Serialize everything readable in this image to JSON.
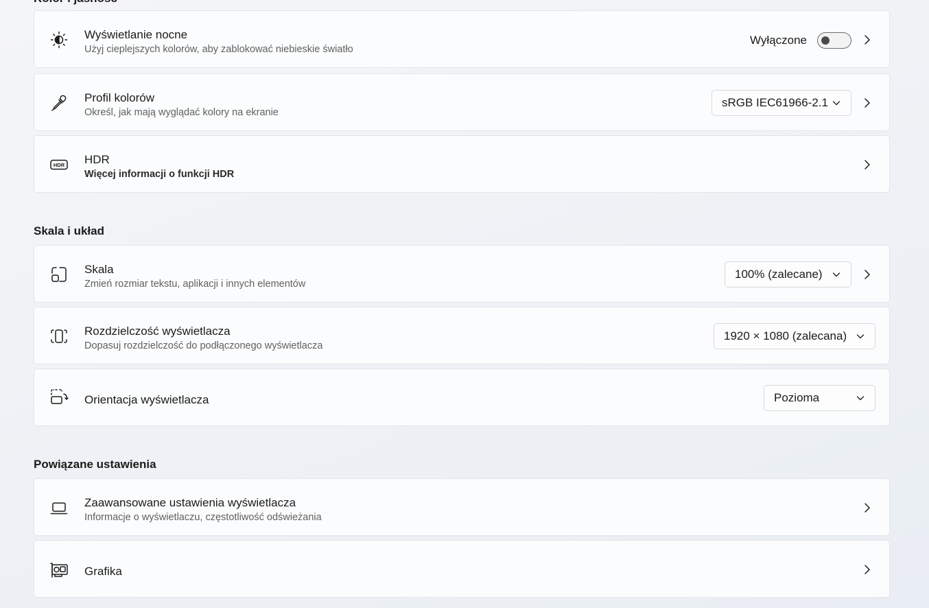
{
  "sections": {
    "color_brightness": {
      "title": "Kolor i jasność"
    },
    "scale_layout": {
      "title": "Skala i układ"
    },
    "related": {
      "title": "Powiązane ustawienia"
    }
  },
  "night_light": {
    "title": "Wyświetlanie nocne",
    "subtitle": "Użyj cieplejszych kolorów, aby zablokować niebieskie światło",
    "toggle_label": "Wyłączone",
    "toggle_on": false,
    "icon": "night-light-icon"
  },
  "color_profile": {
    "title": "Profil kolorów",
    "subtitle": "Określ, jak mają wyglądać kolory na ekranie",
    "value": "sRGB IEC61966-2.1",
    "icon": "eyedropper-icon"
  },
  "hdr": {
    "title": "HDR",
    "subtitle": "Więcej informacji o funkcji HDR",
    "icon": "hdr-icon"
  },
  "scale": {
    "title": "Skala",
    "subtitle": "Zmień rozmiar tekstu, aplikacji i innych elementów",
    "value": "100% (zalecane)",
    "icon": "scale-icon"
  },
  "resolution": {
    "title": "Rozdzielczość wyświetlacza",
    "subtitle": "Dopasuj rozdzielczość do podłączonego wyświetlacza",
    "value": "1920 × 1080 (zalecana)",
    "icon": "resolution-icon"
  },
  "orientation": {
    "title": "Orientacja wyświetlacza",
    "value": "Pozioma",
    "icon": "orientation-icon"
  },
  "advanced_display": {
    "title": "Zaawansowane ustawienia wyświetlacza",
    "subtitle": "Informacje o wyświetlaczu, częstotliwość odświeżania",
    "icon": "laptop-icon"
  },
  "graphics": {
    "title": "Grafika",
    "icon": "graphics-card-icon"
  }
}
